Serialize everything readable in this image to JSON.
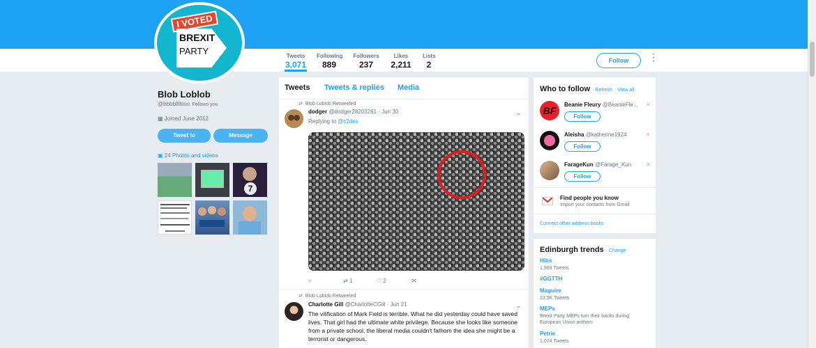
{
  "profile": {
    "name": "Blob Loblob",
    "handle": "@bbbbllllooo",
    "follows_you": "Follows you",
    "joined": "Joined June 2012",
    "tweet_to_label": "Tweet to",
    "message_label": "Message",
    "photos_label": "24 Photos and videos",
    "avatar_stamp": "I VOTED",
    "avatar_line1": "BREXIT",
    "avatar_line2": "PARTY"
  },
  "stats": [
    {
      "label": "Tweets",
      "value": "3,071"
    },
    {
      "label": "Following",
      "value": "889"
    },
    {
      "label": "Followers",
      "value": "237"
    },
    {
      "label": "Likes",
      "value": "2,211"
    },
    {
      "label": "Lists",
      "value": "2"
    }
  ],
  "follow_label": "Follow",
  "timeline": {
    "tabs": [
      "Tweets",
      "Tweets & replies",
      "Media"
    ],
    "tweets": [
      {
        "retweeted_by": "Blob Loblob Retweeted",
        "name": "dodger",
        "handle": "@dodger28203261",
        "date": "· Jun 30",
        "replying_prefix": "Replying to",
        "replying_to": "@c2des",
        "reply_count": "",
        "retweet_count": "1",
        "like_count": "2"
      },
      {
        "retweeted_by": "Blob Loblob Retweeted",
        "name": "Charlotte Gill",
        "handle": "@CharlotteCGill",
        "date": "· Jun 21",
        "text": "The vilification of Mark Field is terrible. What he did yesterday could have saved lives. That girl had the ultimate white privilege. Because she looks like someone from a private school, the liberal media couldn't fathom the idea she might be a terrorist or dangerous."
      }
    ]
  },
  "who_to_follow": {
    "title": "Who to follow",
    "refresh": "· Refresh",
    "view_all": "· View all",
    "accounts": [
      {
        "name": "Beanie Fleury",
        "handle": "@BeanieFle...",
        "follow": "Follow"
      },
      {
        "name": "Aleisha",
        "handle": "@katherine1924",
        "follow": "Follow"
      },
      {
        "name": "FarageKun",
        "handle": "@Farage_Kun",
        "follow": "Follow"
      }
    ],
    "find_title": "Find people you know",
    "find_sub": "Import your contacts from Gmail",
    "connect": "Connect other address books"
  },
  "trends": {
    "title": "Edinburgh trends",
    "change": "· Change",
    "items": [
      {
        "name": "Hibs",
        "sub": "1,569 Tweets"
      },
      {
        "name": "#GGTTH",
        "sub": ""
      },
      {
        "name": "Maguire",
        "sub": "23.5K Tweets"
      },
      {
        "name": "MEPs",
        "sub": "Brexit Party MEPs turn their backs during European Union anthem"
      },
      {
        "name": "Petrie",
        "sub": "1,074 Tweets"
      }
    ]
  },
  "colors": {
    "accent": "#1da1f2",
    "banner": "#1da1f2",
    "background": "#e6ecf0"
  }
}
